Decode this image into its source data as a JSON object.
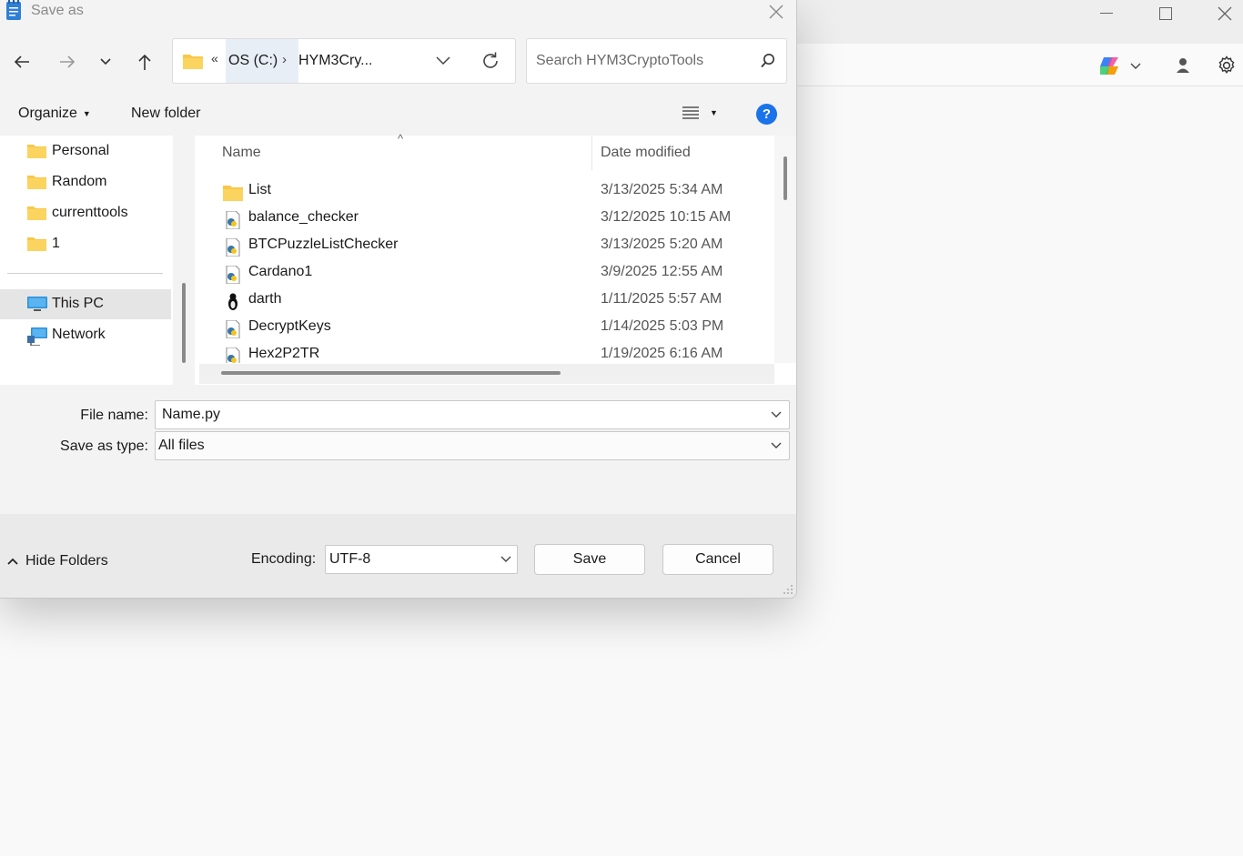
{
  "dialog": {
    "title": "Save as",
    "address": {
      "path_prefix": "«",
      "drive": "OS (C:)",
      "separator": "›",
      "folder": "HYM3Cry..."
    },
    "search": {
      "placeholder": "Search HYM3CryptoTools"
    },
    "toolbar": {
      "organize": "Organize",
      "new_folder": "New folder",
      "help": "?"
    },
    "nav_pane": {
      "items": [
        {
          "label": "Personal",
          "icon": "folder-icon"
        },
        {
          "label": "Random",
          "icon": "folder-icon"
        },
        {
          "label": "currenttools",
          "icon": "folder-icon"
        },
        {
          "label": "1",
          "icon": "folder-icon"
        },
        {
          "label": "This PC",
          "icon": "computer-icon",
          "selected": true
        },
        {
          "label": "Network",
          "icon": "network-icon"
        }
      ]
    },
    "file_list": {
      "columns": [
        "Name",
        "Date modified"
      ],
      "rows": [
        {
          "name": "List",
          "date": "3/13/2025 5:34 AM",
          "icon": "folder-icon"
        },
        {
          "name": "balance_checker",
          "date": "3/12/2025 10:15 AM",
          "icon": "python-file-icon"
        },
        {
          "name": "BTCPuzzleListChecker",
          "date": "3/13/2025 5:20 AM",
          "icon": "python-file-icon"
        },
        {
          "name": "Cardano1",
          "date": "3/9/2025 12:55 AM",
          "icon": "python-file-icon"
        },
        {
          "name": "darth",
          "date": "1/11/2025 5:57 AM",
          "icon": "linux-file-icon"
        },
        {
          "name": "DecryptKeys",
          "date": "1/14/2025 5:03 PM",
          "icon": "python-file-icon"
        },
        {
          "name": "Hex2P2TR",
          "date": "1/19/2025 6:16 AM",
          "icon": "python-file-icon"
        }
      ]
    },
    "fields": {
      "file_name_label": "File name:",
      "file_name_value": "Name.py",
      "save_type_label": "Save as type:",
      "save_type_value": "All files"
    },
    "footer": {
      "hide_folders": "Hide Folders",
      "encoding_label": "Encoding:",
      "encoding_value": "UTF-8",
      "save": "Save",
      "cancel": "Cancel"
    }
  },
  "colors": {
    "accent": "#1a73e8",
    "folder": "#f8c74a",
    "selected": "#e5e5e5"
  }
}
